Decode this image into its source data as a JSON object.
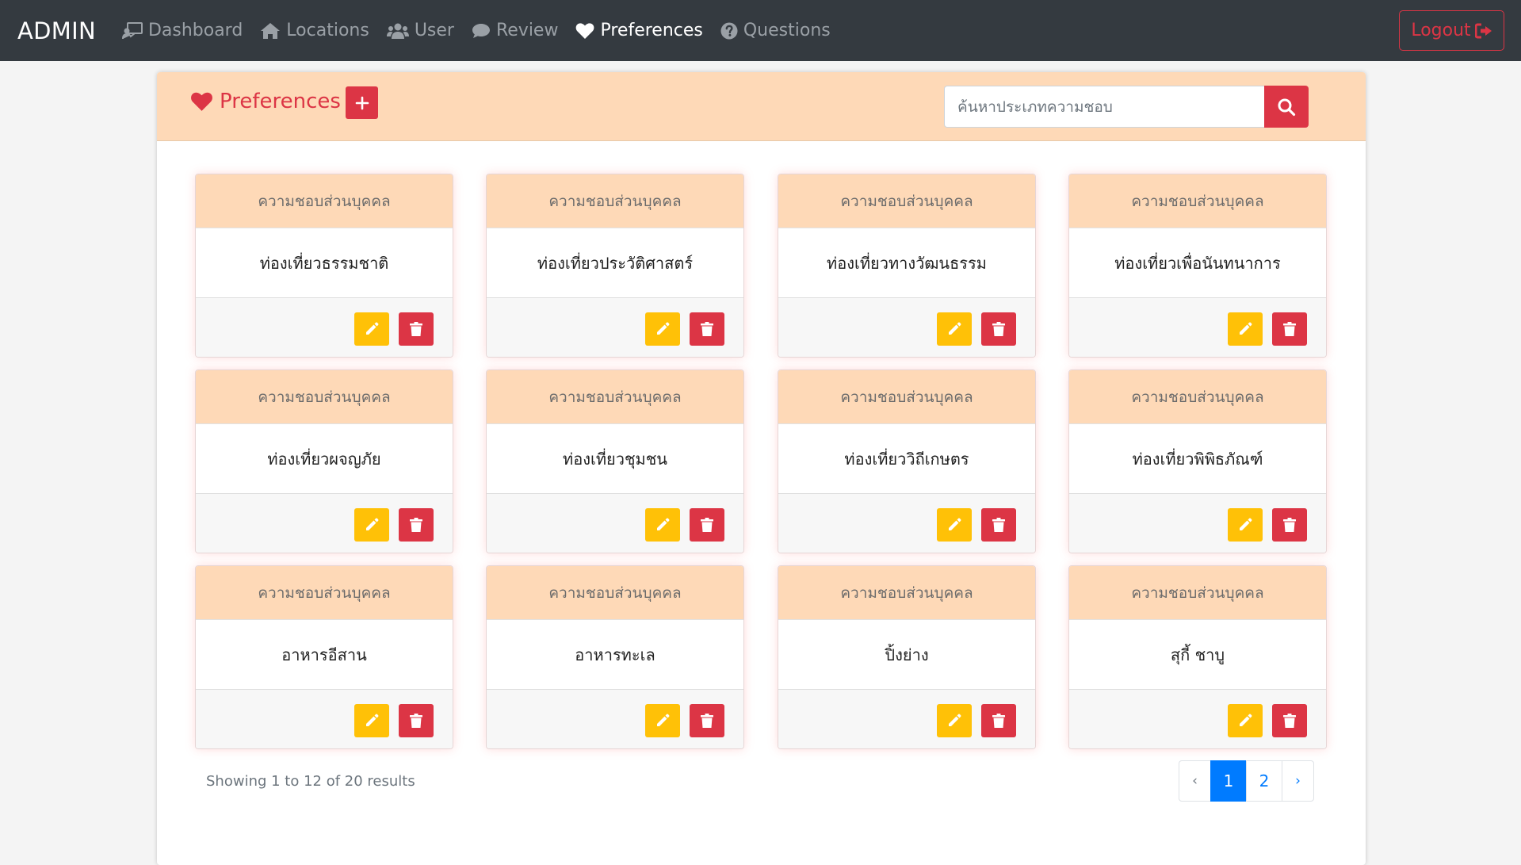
{
  "nav": {
    "brand": "ADMIN",
    "items": [
      {
        "label": "Dashboard",
        "icon": "chalkboard-teacher-icon",
        "active": false
      },
      {
        "label": "Locations",
        "icon": "home-icon",
        "active": false
      },
      {
        "label": "User",
        "icon": "users-icon",
        "active": false
      },
      {
        "label": "Review",
        "icon": "comment-icon",
        "active": false
      },
      {
        "label": "Preferences",
        "icon": "heart-icon",
        "active": true
      },
      {
        "label": "Questions",
        "icon": "question-circle-icon",
        "active": false
      }
    ],
    "logout_label": "Logout"
  },
  "header": {
    "title": "Preferences",
    "search_placeholder": "ค้นหาประเภทความชอบ"
  },
  "cards": [
    {
      "category": "ความชอบส่วนบุคคล",
      "name": "ท่องเที่ยวธรรมชาติ"
    },
    {
      "category": "ความชอบส่วนบุคคล",
      "name": "ท่องเที่ยวประวัติศาสตร์"
    },
    {
      "category": "ความชอบส่วนบุคคล",
      "name": "ท่องเที่ยวทางวัฒนธรรม"
    },
    {
      "category": "ความชอบส่วนบุคคล",
      "name": "ท่องเที่ยวเพื่อนันทนาการ"
    },
    {
      "category": "ความชอบส่วนบุคคล",
      "name": "ท่องเที่ยวผจญภัย"
    },
    {
      "category": "ความชอบส่วนบุคคล",
      "name": "ท่องเที่ยวชุมชน"
    },
    {
      "category": "ความชอบส่วนบุคคล",
      "name": "ท่องเที่ยววิถีเกษตร"
    },
    {
      "category": "ความชอบส่วนบุคคล",
      "name": "ท่องเที่ยวพิพิธภัณฑ์"
    },
    {
      "category": "ความชอบส่วนบุคคล",
      "name": "อาหารอีสาน"
    },
    {
      "category": "ความชอบส่วนบุคคล",
      "name": "อาหารทะเล"
    },
    {
      "category": "ความชอบส่วนบุคคล",
      "name": "ปิ้งย่าง"
    },
    {
      "category": "ความชอบส่วนบุคคล",
      "name": "สุกี้ ชาบู"
    }
  ],
  "footer": {
    "showing_text": "Showing 1 to 12 of 20 results",
    "pagination": {
      "prev": "‹",
      "pages": [
        "1",
        "2"
      ],
      "current": "1",
      "next": "›"
    }
  },
  "colors": {
    "navbar": "#343a40",
    "accent_red": "#dc3545",
    "header_peach": "#fed9b7",
    "edit_yellow": "#ffc107",
    "page_active_blue": "#007bff"
  }
}
